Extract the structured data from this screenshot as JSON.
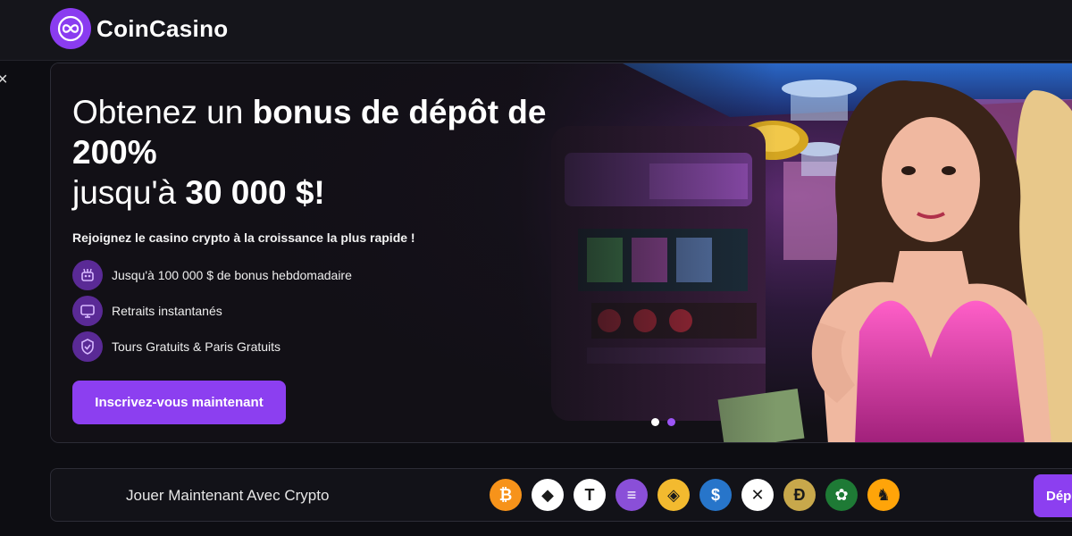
{
  "brand": {
    "name": "CoinCasino",
    "accent": "#8a3cf0"
  },
  "sidebar": {
    "close_icon": "×"
  },
  "hero": {
    "headline_part1": "Obtenez un ",
    "headline_bold": "bonus de dépôt de 200%",
    "headline_part2": "jusqu'à ",
    "headline_amount": "30 000 $!",
    "tagline": "Rejoignez le casino crypto à la croissance la plus rapide !",
    "features": [
      {
        "icon": "robot-icon",
        "label": "Jusqu'à 100 000 $ de bonus hebdomadaire"
      },
      {
        "icon": "monitor-icon",
        "label": "Retraits instantanés"
      },
      {
        "icon": "shield-icon",
        "label": "Tours Gratuits & Paris Gratuits"
      }
    ],
    "cta_label": "Inscrivez-vous maintenant",
    "slides_total": 2,
    "slide_active": 2
  },
  "crypto": {
    "label": "Jouer Maintenant Avec Crypto",
    "coins": [
      {
        "name": "bitcoin-icon",
        "glyph": "₿",
        "color": "#f7931a"
      },
      {
        "name": "ethereum-icon",
        "glyph": "◆",
        "color": "#ffffff"
      },
      {
        "name": "tether-icon",
        "glyph": "T",
        "color": "#ffffff"
      },
      {
        "name": "solana-icon",
        "glyph": "≡",
        "color": "#8a4fd8"
      },
      {
        "name": "bnb-icon",
        "glyph": "◈",
        "color": "#f3ba2f"
      },
      {
        "name": "usdc-icon",
        "glyph": "$",
        "color": "#2775ca"
      },
      {
        "name": "xrp-icon",
        "glyph": "✕",
        "color": "#ffffff"
      },
      {
        "name": "dogecoin-icon",
        "glyph": "Ð",
        "color": "#c8a84b"
      },
      {
        "name": "rose-token-icon",
        "glyph": "✿",
        "color": "#1e7a35"
      },
      {
        "name": "shiba-icon",
        "glyph": "♞",
        "color": "#ffa409"
      }
    ],
    "deposit_label": "Dépôt"
  }
}
